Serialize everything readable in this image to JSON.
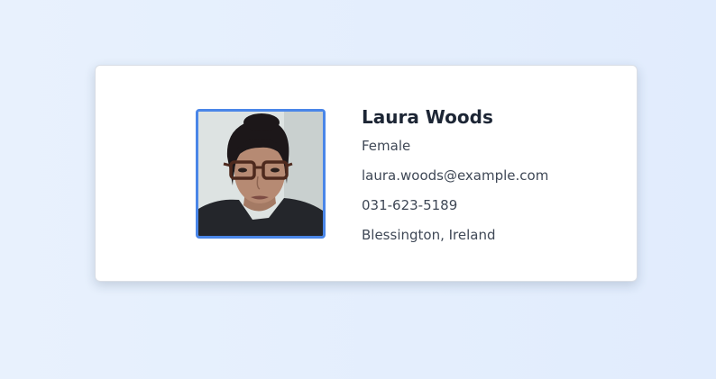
{
  "profile": {
    "name": "Laura Woods",
    "gender": "Female",
    "email": "laura.woods@example.com",
    "phone": "031-623-5189",
    "location": "Blessington, Ireland"
  },
  "colors": {
    "avatar_border": "#4a86e8",
    "name_text": "#1d2635",
    "detail_text": "#3f4856"
  }
}
